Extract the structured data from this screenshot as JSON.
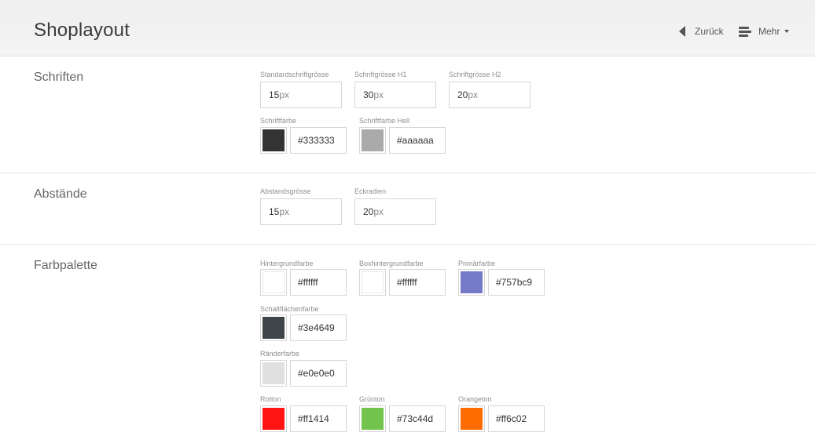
{
  "header": {
    "title": "Shoplayout",
    "back_label": "Zurück",
    "more_label": "Mehr"
  },
  "sections": {
    "fonts": {
      "title": "Schriften",
      "base_size": {
        "label": "Standardschriftgrösse",
        "value": "15",
        "unit": "px"
      },
      "h1_size": {
        "label": "Schriftgrösse H1",
        "value": "30",
        "unit": "px"
      },
      "h2_size": {
        "label": "Schriftgrösse H2",
        "value": "20",
        "unit": "px"
      },
      "font_color": {
        "label": "Schriftfarbe",
        "value": "#333333",
        "color": "#333333"
      },
      "font_color_light": {
        "label": "Schriftfarbe Hell",
        "value": "#aaaaaa",
        "color": "#aaaaaa"
      }
    },
    "spacing": {
      "title": "Abstände",
      "spacing_size": {
        "label": "Abstandsgrösse",
        "value": "15",
        "unit": "px"
      },
      "corner_radius": {
        "label": "Eckradien",
        "value": "20",
        "unit": "px"
      }
    },
    "palette": {
      "title": "Farbpalette",
      "background": {
        "label": "Hintergrundfarbe",
        "value": "#ffffff",
        "color": "#ffffff"
      },
      "box_background": {
        "label": "Boxhintergrundfarbe",
        "value": "#ffffff",
        "color": "#ffffff"
      },
      "primary": {
        "label": "Primärfarbe",
        "value": "#757bc9",
        "color": "#757bc9"
      },
      "button": {
        "label": "Schaltflächenfarbe",
        "value": "#3e4649",
        "color": "#3e4649"
      },
      "border": {
        "label": "Ränderfarbe",
        "value": "#e0e0e0",
        "color": "#e0e0e0"
      },
      "red": {
        "label": "Rotton",
        "value": "#ff1414",
        "color": "#ff1414"
      },
      "green": {
        "label": "Grünton",
        "value": "#73c44d",
        "color": "#73c44d"
      },
      "orange": {
        "label": "Orangeton",
        "value": "#ff6c02",
        "color": "#ff6c02"
      }
    }
  },
  "icons": {
    "back": "caret-left-icon",
    "more": "menu-icon",
    "dropdown": "caret-down-icon"
  }
}
